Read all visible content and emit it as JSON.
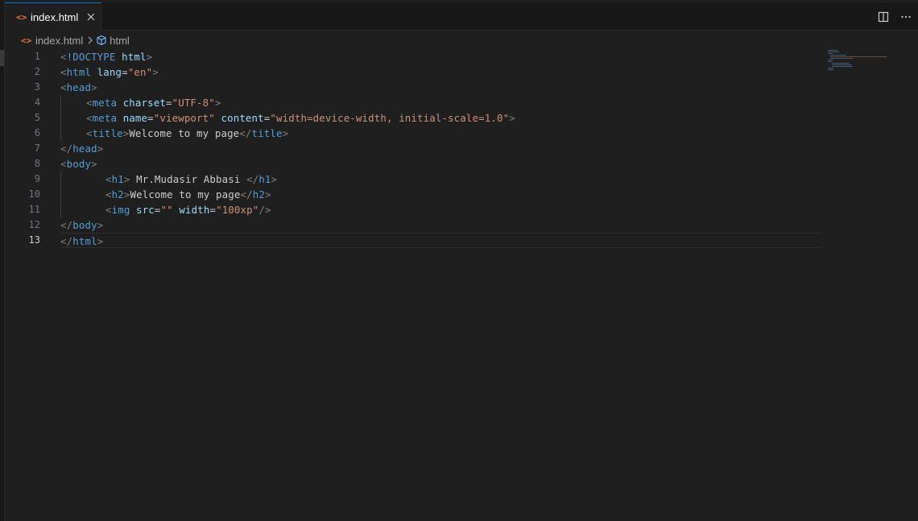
{
  "tab": {
    "label": "index.html",
    "file_icon": "html-file-icon",
    "close_icon": "close-icon"
  },
  "actions": {
    "split_icon": "split-editor-icon",
    "more_icon": "more-actions-icon"
  },
  "breadcrumb": {
    "file": "index.html",
    "symbol": "html"
  },
  "editor": {
    "active_line": 13,
    "line_numbers": [
      "1",
      "2",
      "3",
      "4",
      "5",
      "6",
      "7",
      "8",
      "9",
      "10",
      "11",
      "12",
      "13"
    ]
  },
  "code": {
    "l1": {
      "open": "<",
      "name": "!DOCTYPE",
      "attr": " html",
      "close": ">"
    },
    "l2": {
      "open": "<",
      "name": "html",
      "attr": " lang",
      "eq": "=",
      "val": "\"en\"",
      "close": ">"
    },
    "l3": {
      "open": "<",
      "name": "head",
      "close": ">"
    },
    "l4": {
      "open": "<",
      "name": "meta",
      "attr": " charset",
      "eq": "=",
      "val": "\"UTF-8\"",
      "close": ">"
    },
    "l5": {
      "open": "<",
      "name": "meta",
      "attr1": " name",
      "eq1": "=",
      "val1": "\"viewport\"",
      "attr2": " content",
      "eq2": "=",
      "val2": "\"width=device-width, initial-scale=1.0\"",
      "close": ">"
    },
    "l6": {
      "open": "<",
      "name": "title",
      "close": ">",
      "text": "Welcome to my page",
      "end_open": "</",
      "end_name": "title",
      "end_close": ">"
    },
    "l7": {
      "open": "</",
      "name": "head",
      "close": ">"
    },
    "l8": {
      "open": "<",
      "name": "body",
      "close": ">"
    },
    "l9": {
      "open": "<",
      "name": "h1",
      "close": ">",
      "text": " Mr.Mudasir Abbasi ",
      "end_open": "</",
      "end_name": "h1",
      "end_close": ">"
    },
    "l10": {
      "open": "<",
      "name": "h2",
      "close": ">",
      "text": "Welcome to my page",
      "end_open": "</",
      "end_name": "h2",
      "end_close": ">"
    },
    "l11": {
      "open": "<",
      "name": "img",
      "attr1": " src",
      "eq1": "=",
      "val1": "\"\"",
      "attr2": " width",
      "eq2": "=",
      "val2": "\"100xp\"",
      "close": "/>"
    },
    "l12": {
      "open": "</",
      "name": "body",
      "close": ">"
    },
    "l13": {
      "open": "</",
      "name": "html",
      "close": ">"
    }
  },
  "colors": {
    "tag": "#569cd6",
    "attribute": "#9cdcfe",
    "string": "#ce9178",
    "bracket": "#808080",
    "text": "#cccccc",
    "tab_accent": "#0078d4",
    "html_icon": "#e37933"
  }
}
